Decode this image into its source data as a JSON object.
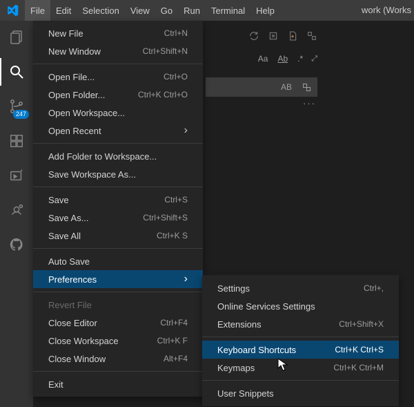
{
  "titlebar": {
    "title": "work (Works"
  },
  "menubar": [
    "File",
    "Edit",
    "Selection",
    "View",
    "Go",
    "Run",
    "Terminal",
    "Help"
  ],
  "menubar_active_index": 0,
  "activity_badge": "247",
  "find": {
    "aa": "Aa",
    "ab_underline": "Ab",
    "ab_caps": "AB"
  },
  "file_menu": {
    "groups": [
      [
        {
          "id": "new-file",
          "label": "New File",
          "shortcut": "Ctrl+N"
        },
        {
          "id": "new-window",
          "label": "New Window",
          "shortcut": "Ctrl+Shift+N"
        }
      ],
      [
        {
          "id": "open-file",
          "label": "Open File...",
          "shortcut": "Ctrl+O"
        },
        {
          "id": "open-folder",
          "label": "Open Folder...",
          "shortcut": "Ctrl+K Ctrl+O"
        },
        {
          "id": "open-workspace",
          "label": "Open Workspace...",
          "shortcut": ""
        },
        {
          "id": "open-recent",
          "label": "Open Recent",
          "shortcut": "",
          "submenu": true
        }
      ],
      [
        {
          "id": "add-folder",
          "label": "Add Folder to Workspace...",
          "shortcut": ""
        },
        {
          "id": "save-workspace-as",
          "label": "Save Workspace As...",
          "shortcut": ""
        }
      ],
      [
        {
          "id": "save",
          "label": "Save",
          "shortcut": "Ctrl+S"
        },
        {
          "id": "save-as",
          "label": "Save As...",
          "shortcut": "Ctrl+Shift+S"
        },
        {
          "id": "save-all",
          "label": "Save All",
          "shortcut": "Ctrl+K S"
        }
      ],
      [
        {
          "id": "auto-save",
          "label": "Auto Save",
          "shortcut": ""
        },
        {
          "id": "preferences",
          "label": "Preferences",
          "shortcut": "",
          "submenu": true,
          "highlight": true
        }
      ],
      [
        {
          "id": "revert-file",
          "label": "Revert File",
          "shortcut": "",
          "disabled": true
        },
        {
          "id": "close-editor",
          "label": "Close Editor",
          "shortcut": "Ctrl+F4"
        },
        {
          "id": "close-workspace",
          "label": "Close Workspace",
          "shortcut": "Ctrl+K F"
        },
        {
          "id": "close-window",
          "label": "Close Window",
          "shortcut": "Alt+F4"
        }
      ],
      [
        {
          "id": "exit",
          "label": "Exit",
          "shortcut": ""
        }
      ]
    ]
  },
  "preferences_submenu": {
    "groups": [
      [
        {
          "id": "settings",
          "label": "Settings",
          "shortcut": "Ctrl+,"
        },
        {
          "id": "online-services",
          "label": "Online Services Settings",
          "shortcut": ""
        },
        {
          "id": "extensions",
          "label": "Extensions",
          "shortcut": "Ctrl+Shift+X"
        }
      ],
      [
        {
          "id": "keyboard-shortcuts",
          "label": "Keyboard Shortcuts",
          "shortcut": "Ctrl+K Ctrl+S",
          "highlight": true
        },
        {
          "id": "keymaps",
          "label": "Keymaps",
          "shortcut": "Ctrl+K Ctrl+M"
        }
      ],
      [
        {
          "id": "user-snippets",
          "label": "User Snippets",
          "shortcut": ""
        }
      ]
    ]
  }
}
